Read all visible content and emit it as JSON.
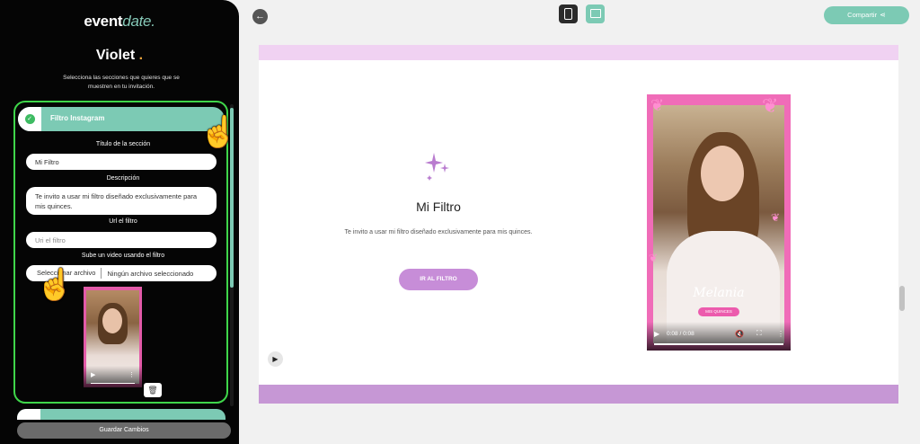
{
  "sidebar": {
    "logo_main": "event",
    "logo_accent": "date",
    "logo_suffix": ".",
    "theme_name": "Violet",
    "theme_dot": ".",
    "intro": "Selecciona las secciones que quieres que se muestren en tu invitación.",
    "section_title": "Filtro Instagram",
    "fields": {
      "section_title_label": "Título de la sección",
      "section_title_value": "Mi Filtro",
      "description_label": "Descripción",
      "description_value": "Te invito a usar mi filtro diseñado exclusivamente para mis quinces.",
      "url_label": "Url el filtro",
      "url_placeholder": "Uri el filtro",
      "video_label": "Sube un video usando el filtro",
      "file_button": "Seleccionar archivo",
      "file_status": "Ningún archivo seleccionado"
    },
    "save_button": "Guardar Cambios"
  },
  "topbar": {
    "share_label": "Compartir"
  },
  "preview": {
    "filter_title": "Mi Filtro",
    "filter_description": "Te invito a usar mi filtro diseñado exclusivamente para mis quinces.",
    "go_button": "IR AL FILTRO",
    "video_name": "Melania",
    "video_badge": "MIS QUINCES",
    "video_time": "0:08 / 0:08"
  },
  "icons": {
    "back": "arrow-left-icon",
    "mobile": "mobile-device-icon",
    "desktop": "laptop-device-icon",
    "share": "share-icon",
    "check": "check-icon",
    "trash": "trash-icon",
    "sparkle": "sparkle-icon",
    "pointer": "hand-pointer-icon"
  },
  "colors": {
    "accent": "#7ccab4",
    "active_border": "#3fd64a",
    "button_purple": "#c78dd8",
    "band_top": "#f0d2f2",
    "band_bottom": "#c697d5",
    "video_frame": "#f06cb8"
  }
}
